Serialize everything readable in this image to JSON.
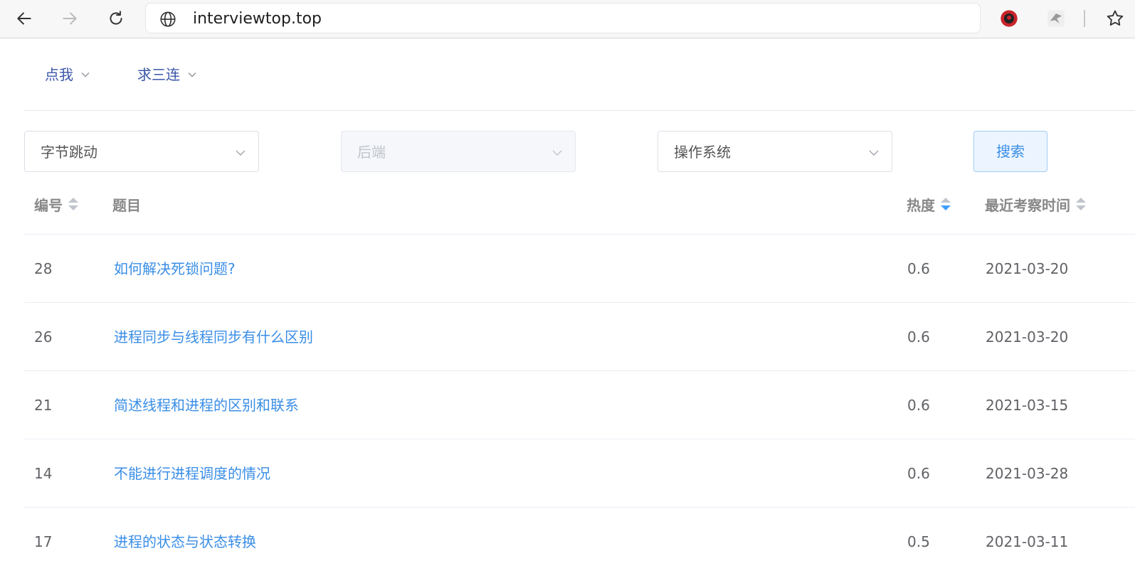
{
  "browser": {
    "url": "interviewtop.top"
  },
  "menu": {
    "items": [
      {
        "label": "点我"
      },
      {
        "label": "求三连"
      }
    ]
  },
  "filters": {
    "company": "字节跳动",
    "role": "后端",
    "topic": "操作系统",
    "search_label": "搜索"
  },
  "table": {
    "headers": {
      "id": "编号",
      "title": "题目",
      "heat": "热度",
      "last_time": "最近考察时间"
    },
    "rows": [
      {
        "id": "28",
        "title": "如何解决死锁问题?",
        "heat": "0.6",
        "date": "2021-03-20"
      },
      {
        "id": "26",
        "title": "进程同步与线程同步有什么区别",
        "heat": "0.6",
        "date": "2021-03-20"
      },
      {
        "id": "21",
        "title": "简述线程和进程的区别和联系",
        "heat": "0.6",
        "date": "2021-03-15"
      },
      {
        "id": "14",
        "title": "不能进行进程调度的情况",
        "heat": "0.6",
        "date": "2021-03-28"
      },
      {
        "id": "17",
        "title": "进程的状态与状态转换",
        "heat": "0.5",
        "date": "2021-03-11"
      }
    ]
  },
  "colors": {
    "link": "#3a8ee6",
    "menu": "#3a56a8",
    "sort_active": "#409eff"
  }
}
